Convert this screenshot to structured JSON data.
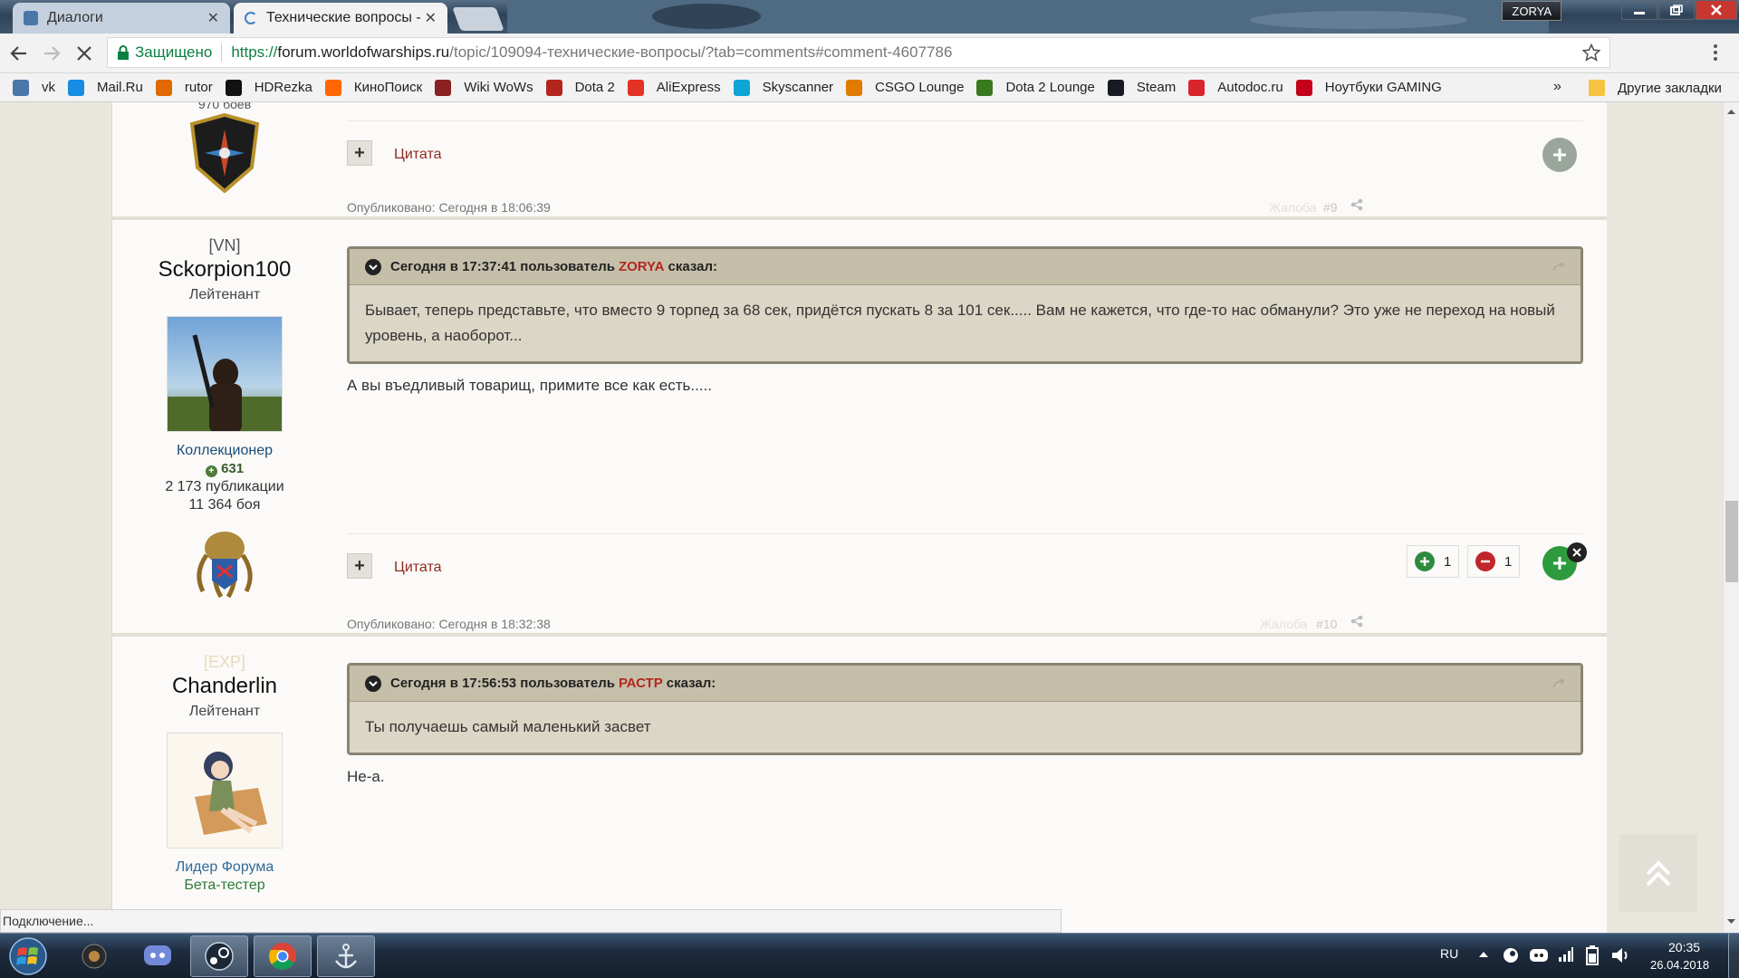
{
  "browser": {
    "tabs": [
      {
        "title": "Диалоги",
        "active": false
      },
      {
        "title": "Технические вопросы -",
        "active": true
      }
    ],
    "user_badge": "ZORYA",
    "address": {
      "secure_label": "Защищено",
      "scheme": "https://",
      "host": "forum.worldofwarships.ru",
      "path": "/topic/109094-технические-вопросы/?tab=comments#comment-4607786"
    },
    "bookmarks": [
      {
        "label": "vk",
        "icon": "vk-icon",
        "color": "#4a76a8"
      },
      {
        "label": "Mail.Ru",
        "icon": "mailru-icon",
        "color": "#168de2"
      },
      {
        "label": "rutor",
        "icon": "rutor-icon",
        "color": "#e06a00"
      },
      {
        "label": "HDRezka",
        "icon": "hd-icon",
        "color": "#111111"
      },
      {
        "label": "КиноПоиск",
        "icon": "kinopoisk-icon",
        "color": "#f60"
      },
      {
        "label": "Wiki WoWs",
        "icon": "wowsiki-icon",
        "color": "#8a2222"
      },
      {
        "label": "Dota 2",
        "icon": "dota-icon",
        "color": "#b3261e"
      },
      {
        "label": "AliExpress",
        "icon": "aliexpress-icon",
        "color": "#e43225"
      },
      {
        "label": "Skyscanner",
        "icon": "skyscanner-icon",
        "color": "#0ea5d6"
      },
      {
        "label": "CSGO Lounge",
        "icon": "csgo-lounge-icon",
        "color": "#e07b00"
      },
      {
        "label": "Dota 2 Lounge",
        "icon": "dota-lounge-icon",
        "color": "#3a7a1e"
      },
      {
        "label": "Steam",
        "icon": "steam-icon",
        "color": "#171a21"
      },
      {
        "label": "Autodoc.ru",
        "icon": "autodoc-icon",
        "color": "#d9232d"
      },
      {
        "label": "Ноутбуки GAMING",
        "icon": "msi-icon",
        "color": "#c4001a"
      }
    ],
    "bookmarks_more": "»",
    "other_bookmarks": "Другие закладки",
    "status_text": "Подключение..."
  },
  "posts": [
    {
      "id": "prev",
      "author": {
        "battles_partial": "970 боёв"
      },
      "quote_label": "Цитата"
    },
    {
      "id": "9",
      "author": {
        "clan": "[VN]",
        "name": "Sckorpion100",
        "rank": "Лейтенант",
        "group": "Коллекционер",
        "reputation": "631",
        "publications": "2 173 публикации",
        "battles": "11 364 боя"
      },
      "published": "Опубликовано: Сегодня в 18:06:39",
      "report": "Жалоба",
      "number": "#9",
      "quote": {
        "head_prefix": "Сегодня в 17:37:41 пользователь",
        "user": "ZORYA",
        "head_suffix": "сказал:",
        "text": "Бывает, теперь представьте, что вместо 9 торпед за 68 сек, придётся пускать 8 за 101 сек..... Вам не кажется, что где-то нас обманули? Это уже не переход на новый уровень, а наоборот..."
      },
      "text": "А вы въедливый товарищ, примите все как есть.....",
      "quote_label": "Цитата",
      "likes": "1",
      "dislikes": "1"
    },
    {
      "id": "10",
      "author": {
        "clan": "[EXP]",
        "name": "Chanderlin",
        "rank": "Лейтенант",
        "group": "Лидер Форума",
        "group2": "Бета-тестер"
      },
      "published": "Опубликовано: Сегодня в 18:32:38",
      "report": "Жалоба",
      "number": "#10",
      "quote": {
        "head_prefix": "Сегодня в 17:56:53 пользователь",
        "user": "РАСТР",
        "head_suffix": "сказал:",
        "text": "Ты получаешь самый маленький засвет"
      },
      "text": "Не-а."
    }
  ],
  "taskbar": {
    "lang": "RU",
    "time": "20:35",
    "date": "26.04.2018"
  }
}
